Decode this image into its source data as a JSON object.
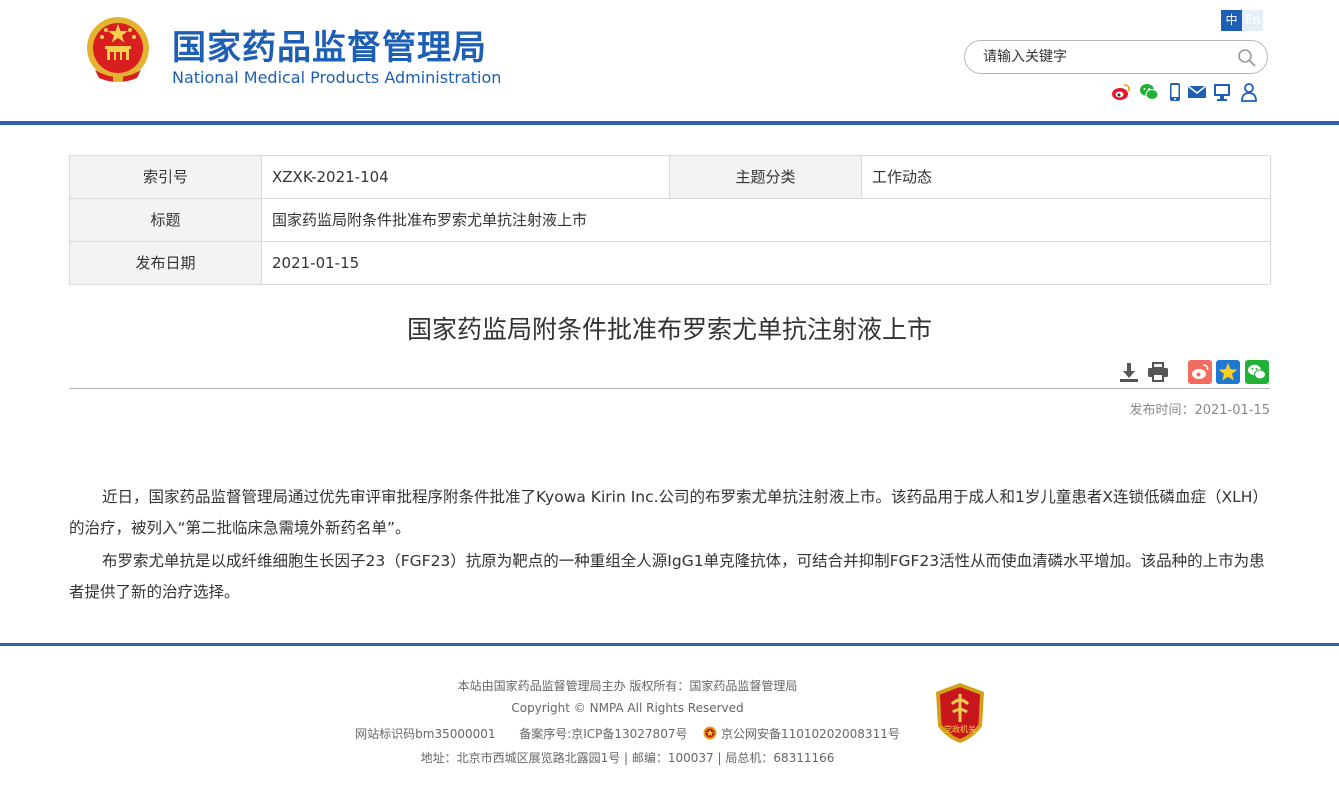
{
  "header": {
    "site_name_cn": "国家药品监督管理局",
    "site_name_en": "National Medical Products Administration",
    "lang_zh": "中",
    "lang_en": "En",
    "search_placeholder": "请输入关键字",
    "social_icons": [
      "weibo-icon",
      "wechat-icon",
      "mobile-icon",
      "email-icon",
      "screen-icon",
      "user-icon"
    ]
  },
  "info_table": {
    "index_label": "索引号",
    "index_value": "XZXK-2021-104",
    "topic_label": "主题分类",
    "topic_value": "工作动态",
    "title_label": "标题",
    "title_value": "国家药监局附条件批准布罗索尤单抗注射液上市",
    "date_label": "发布日期",
    "date_value": "2021-01-15"
  },
  "article": {
    "title": "国家药监局附条件批准布罗索尤单抗注射液上市",
    "tools": [
      "download-icon",
      "print-icon",
      "weibo-share-icon",
      "favorite-icon",
      "wechat-share-icon"
    ],
    "publish_time": "发布时间：2021-01-15",
    "paragraphs": [
      "近日，国家药品监督管理局通过优先审评审批程序附条件批准了Kyowa Kirin Inc.公司的布罗索尤单抗注射液上市。该药品用于成人和1岁儿童患者X连锁低磷血症（XLH）的治疗，被列入“第二批临床急需境外新药名单”。",
      "布罗索尤单抗是以成纤维细胞生长因子23（FGF23）抗原为靶点的一种重组全人源IgG1单克隆抗体，可结合并抑制FGF23活性从而使血清磷水平增加。该品种的上市为患者提供了新的治疗选择。"
    ]
  },
  "footer": {
    "line1": "本站由国家药品监督管理局主办 版权所有：国家药品监督管理局",
    "line2": "Copyright © NMPA All Rights Reserved",
    "site_code": "网站标识码bm35000001",
    "icp": "备案序号:京ICP备13027807号",
    "police": "京公网安备11010202008311号",
    "line4": "地址：北京市西城区展览路北露园1号 | 邮编：100037 | 局总机：68311166",
    "badge_text": "党政机关"
  },
  "colors": {
    "brand_blue": "#1c5fb5",
    "bar_blue": "#2c63b0",
    "weibo_red": "#e6162d",
    "wechat_green": "#20b137",
    "favorite_blue": "#1f78d1"
  }
}
